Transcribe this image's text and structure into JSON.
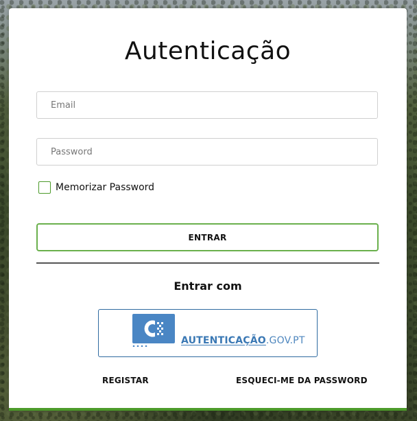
{
  "login": {
    "title": "Autenticação",
    "email_placeholder": "Email",
    "password_placeholder": "Password",
    "remember_label": "Memorizar Password",
    "remember_checked": false,
    "enter_label": "ENTRAR",
    "enter_with": "Entrar com",
    "gov_auth": {
      "text_strong": "AUTENTICAÇÃO",
      "text_light": ".GOV.PT",
      "logo_icon": "autenticacao-gov-logo-icon"
    },
    "register_label": "REGISTAR",
    "forgot_label": "ESQUECI-ME DA PASSWORD"
  },
  "colors": {
    "accent_green": "#6ab04c",
    "bottom_bar_green": "#4c9a2a",
    "gov_blue": "#3a78b4"
  }
}
